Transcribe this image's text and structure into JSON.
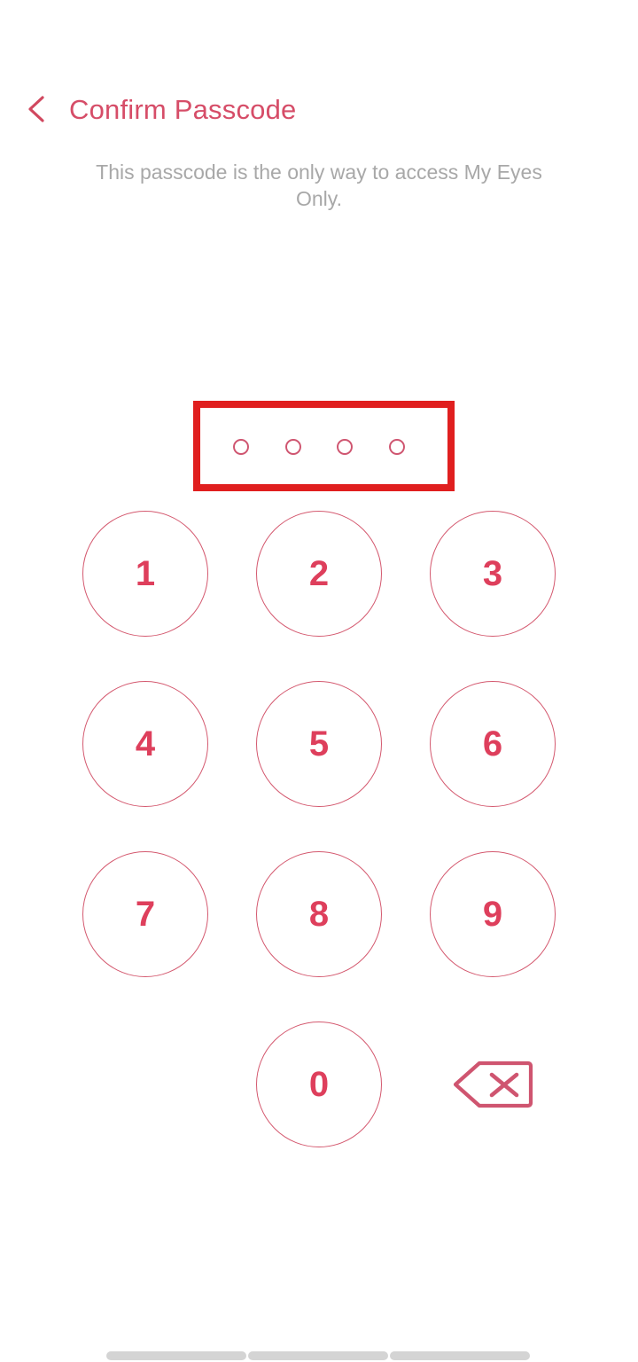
{
  "colors": {
    "accent": "#d64d68",
    "digit": "#de3f5c",
    "key_stroke": "#d4596f",
    "dot_stroke": "#cf5570",
    "subtitle": "#a8a8a8",
    "annotation": "#e01f1f",
    "nav_bar": "#d4d4d4",
    "background": "#ffffff"
  },
  "header": {
    "back_icon": "chevron-left-icon",
    "title": "Confirm Passcode"
  },
  "subtitle": {
    "text": "This passcode is the only way to access My Eyes Only."
  },
  "passcode": {
    "length": 4,
    "entered": 0,
    "dots": [
      {
        "filled": false
      },
      {
        "filled": false
      },
      {
        "filled": false
      },
      {
        "filled": false
      }
    ]
  },
  "annotation": {
    "present": true,
    "target": "passcode-dots-row",
    "shape": "rectangle",
    "stroke_px": 8
  },
  "keypad": {
    "keys": [
      {
        "label": "1",
        "type": "digit",
        "col": 0,
        "row": 0
      },
      {
        "label": "2",
        "type": "digit",
        "col": 1,
        "row": 0
      },
      {
        "label": "3",
        "type": "digit",
        "col": 2,
        "row": 0
      },
      {
        "label": "4",
        "type": "digit",
        "col": 0,
        "row": 1
      },
      {
        "label": "5",
        "type": "digit",
        "col": 1,
        "row": 1
      },
      {
        "label": "6",
        "type": "digit",
        "col": 2,
        "row": 1
      },
      {
        "label": "7",
        "type": "digit",
        "col": 0,
        "row": 2
      },
      {
        "label": "8",
        "type": "digit",
        "col": 1,
        "row": 2
      },
      {
        "label": "9",
        "type": "digit",
        "col": 2,
        "row": 2
      },
      {
        "label": "",
        "type": "blank",
        "col": 0,
        "row": 3
      },
      {
        "label": "0",
        "type": "digit",
        "col": 1,
        "row": 3
      },
      {
        "label": "backspace-icon",
        "type": "backspace",
        "col": 2,
        "row": 3
      }
    ]
  },
  "nav_bar": {
    "segments": [
      "recents",
      "home",
      "back"
    ]
  }
}
